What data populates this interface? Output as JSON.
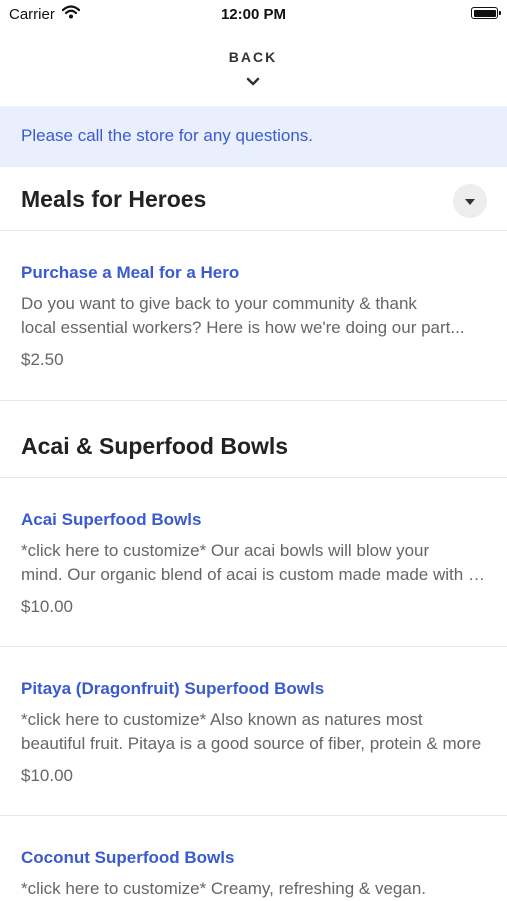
{
  "status_bar": {
    "carrier": "Carrier",
    "time": "12:00 PM"
  },
  "nav": {
    "back_label": "BACK"
  },
  "notice": "Please call the store for any questions.",
  "sections": [
    {
      "title": "Meals for Heroes",
      "items": [
        {
          "name": "Purchase a Meal for a Hero",
          "desc_lines": [
            "Do you want to give back to your community & thank",
            "local essential workers? Here is how we're doing our part..."
          ],
          "price": "$2.50"
        }
      ]
    },
    {
      "title": "Acai & Superfood Bowls",
      "items": [
        {
          "name": "Acai Superfood Bowls",
          "desc_lines": [
            "*click here to customize* Our acai bowls will blow your",
            "mind. Our organic blend of acai is custom made made with love"
          ],
          "price": "$10.00"
        },
        {
          "name": "Pitaya (Dragonfruit) Superfood Bowls",
          "desc_lines": [
            "*click here to customize* Also known as natures most",
            "beautiful fruit. Pitaya is a good source of fiber, protein & more"
          ],
          "price": "$10.00"
        },
        {
          "name": "Coconut Superfood Bowls",
          "desc_lines": [
            "*click here to customize* Creamy, refreshing & vegan."
          ],
          "price": ""
        }
      ]
    }
  ]
}
